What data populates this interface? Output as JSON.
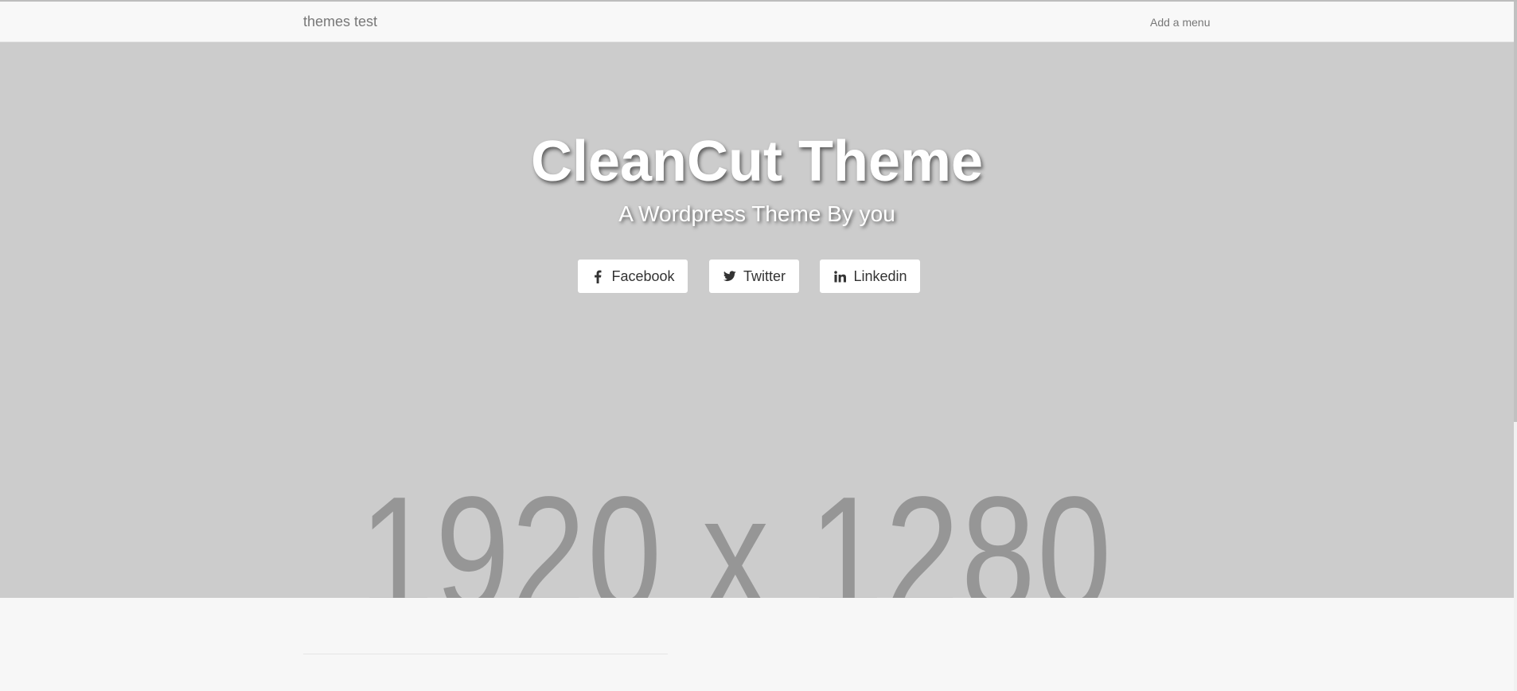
{
  "navbar": {
    "brand": "themes test",
    "menu_link": "Add a menu"
  },
  "hero": {
    "title": "CleanCut Theme",
    "subtitle": "A Wordpress Theme By you",
    "placeholder_text": "1920 x 1280",
    "background_color": "#cccccc"
  },
  "social_buttons": [
    {
      "label": "Facebook",
      "icon": "facebook-icon"
    },
    {
      "label": "Twitter",
      "icon": "twitter-icon"
    },
    {
      "label": "Linkedin",
      "icon": "linkedin-icon"
    }
  ],
  "colors": {
    "page_background": "#f7f7f7",
    "hero_text": "#ffffff",
    "placeholder_text": "#969696",
    "button_text": "#333333"
  }
}
